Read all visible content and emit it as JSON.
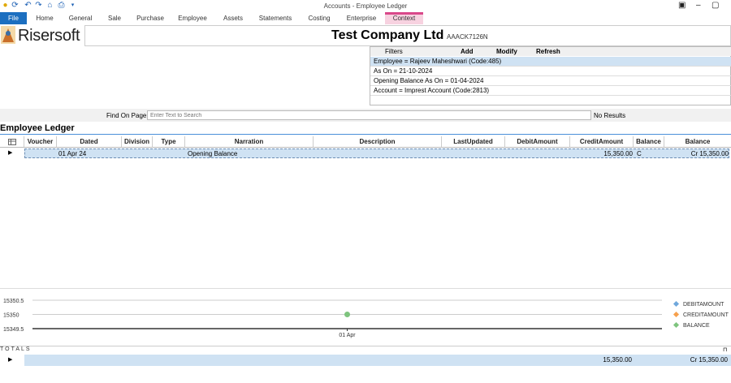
{
  "window": {
    "title": "Accounts - Employee Ledger"
  },
  "ribbon": {
    "tabs": [
      "File",
      "Home",
      "General",
      "Sale",
      "Purchase",
      "Employee",
      "Assets",
      "Statements",
      "Costing",
      "Enterprise",
      "Context"
    ]
  },
  "logo": {
    "text": "Risersoft"
  },
  "company": {
    "name": "Test Company Ltd",
    "code": "AAACK7126N"
  },
  "filters": {
    "header": "Filters",
    "add": "Add",
    "modify": "Modify",
    "refresh": "Refresh",
    "rows": [
      "Employee = Rajeev  Maheshwari (Code:485)",
      "As On =  21-10-2024",
      "Opening Balance As On =  01-04-2024",
      "Account = Imprest Account (Code:2813)"
    ]
  },
  "find": {
    "label": "Find On Page",
    "placeholder": "Enter Text to Search",
    "result": "No Results"
  },
  "ledger": {
    "title": "Employee Ledger",
    "columns": [
      "Voucher",
      "Dated",
      "Division",
      "Type",
      "Narration",
      "Description",
      "LastUpdated",
      "DebitAmount",
      "CreditAmount",
      "Balance",
      "Balance"
    ],
    "rows": [
      {
        "voucher": "",
        "dated": "01 Apr 24",
        "division": "",
        "type": "",
        "narration": "Opening Balance",
        "description": "",
        "last_updated": "",
        "debit": "",
        "credit": "15,350.00",
        "balance_type": "C",
        "balance": "Cr 15,350.00"
      }
    ]
  },
  "chart_data": {
    "type": "line",
    "x": [
      "01 Apr"
    ],
    "series": [
      {
        "name": "DEBITAMOUNT",
        "values": []
      },
      {
        "name": "CREDITAMOUNT",
        "values": []
      },
      {
        "name": "BALANCE",
        "values": [
          15350
        ]
      }
    ],
    "yticks": [
      "15350.5",
      "15350",
      "15349.5"
    ],
    "ylim": [
      15349.5,
      15350.5
    ],
    "legend": "right",
    "colors": {
      "DEBITAMOUNT": "#6fa8dc",
      "CREDITAMOUNT": "#f6a04d",
      "BALANCE": "#7ec47e"
    }
  },
  "totals": {
    "label": "TOTALS",
    "credit": "15,350.00",
    "balance": "Cr 15,350.00"
  }
}
